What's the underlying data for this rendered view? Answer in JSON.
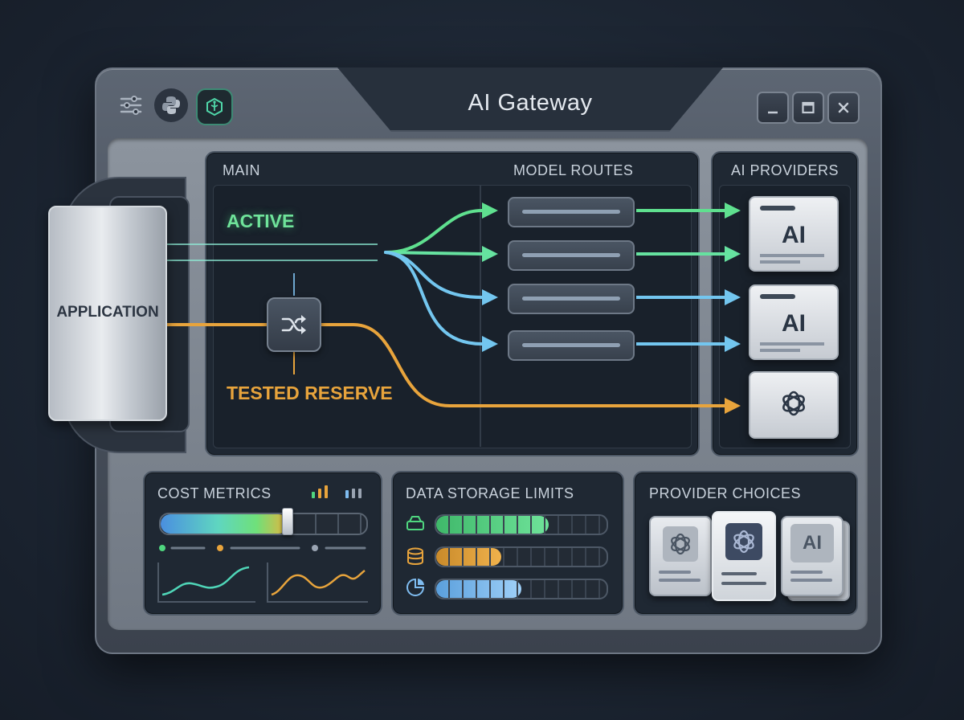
{
  "window": {
    "title": "AI Gateway",
    "toolbar_icons": [
      "sliders-icon",
      "python-icon",
      "circuit-box-icon"
    ],
    "controls": [
      "minimize-icon",
      "maximize-icon",
      "close-icon"
    ]
  },
  "application": {
    "label": "APPLICATION"
  },
  "main": {
    "title": "MAIN",
    "routes_title": "MODEL ROUTES",
    "active_label": "ACTIVE",
    "reserve_label": "TESTED RESERVE",
    "shuffle_icon": "shuffle-icon"
  },
  "providers": {
    "title": "AI PROVIDERS",
    "cards": [
      {
        "label": "AI",
        "icon": "ai-text-icon"
      },
      {
        "label": "AI",
        "icon": "ai-text-icon"
      },
      {
        "label": "",
        "icon": "openai-logo-icon"
      }
    ]
  },
  "cost_metrics": {
    "title": "COST METRICS",
    "slider_level": 0.62
  },
  "storage": {
    "title": "DATA STORAGE LIMITS",
    "bars": [
      {
        "icon": "drive-icon",
        "level": 0.66,
        "color": "#4fd67f"
      },
      {
        "icon": "database-icon",
        "level": 0.38,
        "color": "#e8a43c"
      },
      {
        "icon": "pie-chart-icon",
        "level": 0.5,
        "color": "#7fbcf0"
      }
    ]
  },
  "provider_choices": {
    "title": "PROVIDER CHOICES",
    "options": [
      {
        "icon": "openai-logo-icon",
        "label": ""
      },
      {
        "icon": "openai-logo-icon",
        "label": ""
      },
      {
        "icon": "ai-text-icon",
        "label": "AI"
      }
    ]
  },
  "colors": {
    "active": "#5fe08f",
    "route_blue": "#73c6ef",
    "reserve": "#e8a43c"
  }
}
